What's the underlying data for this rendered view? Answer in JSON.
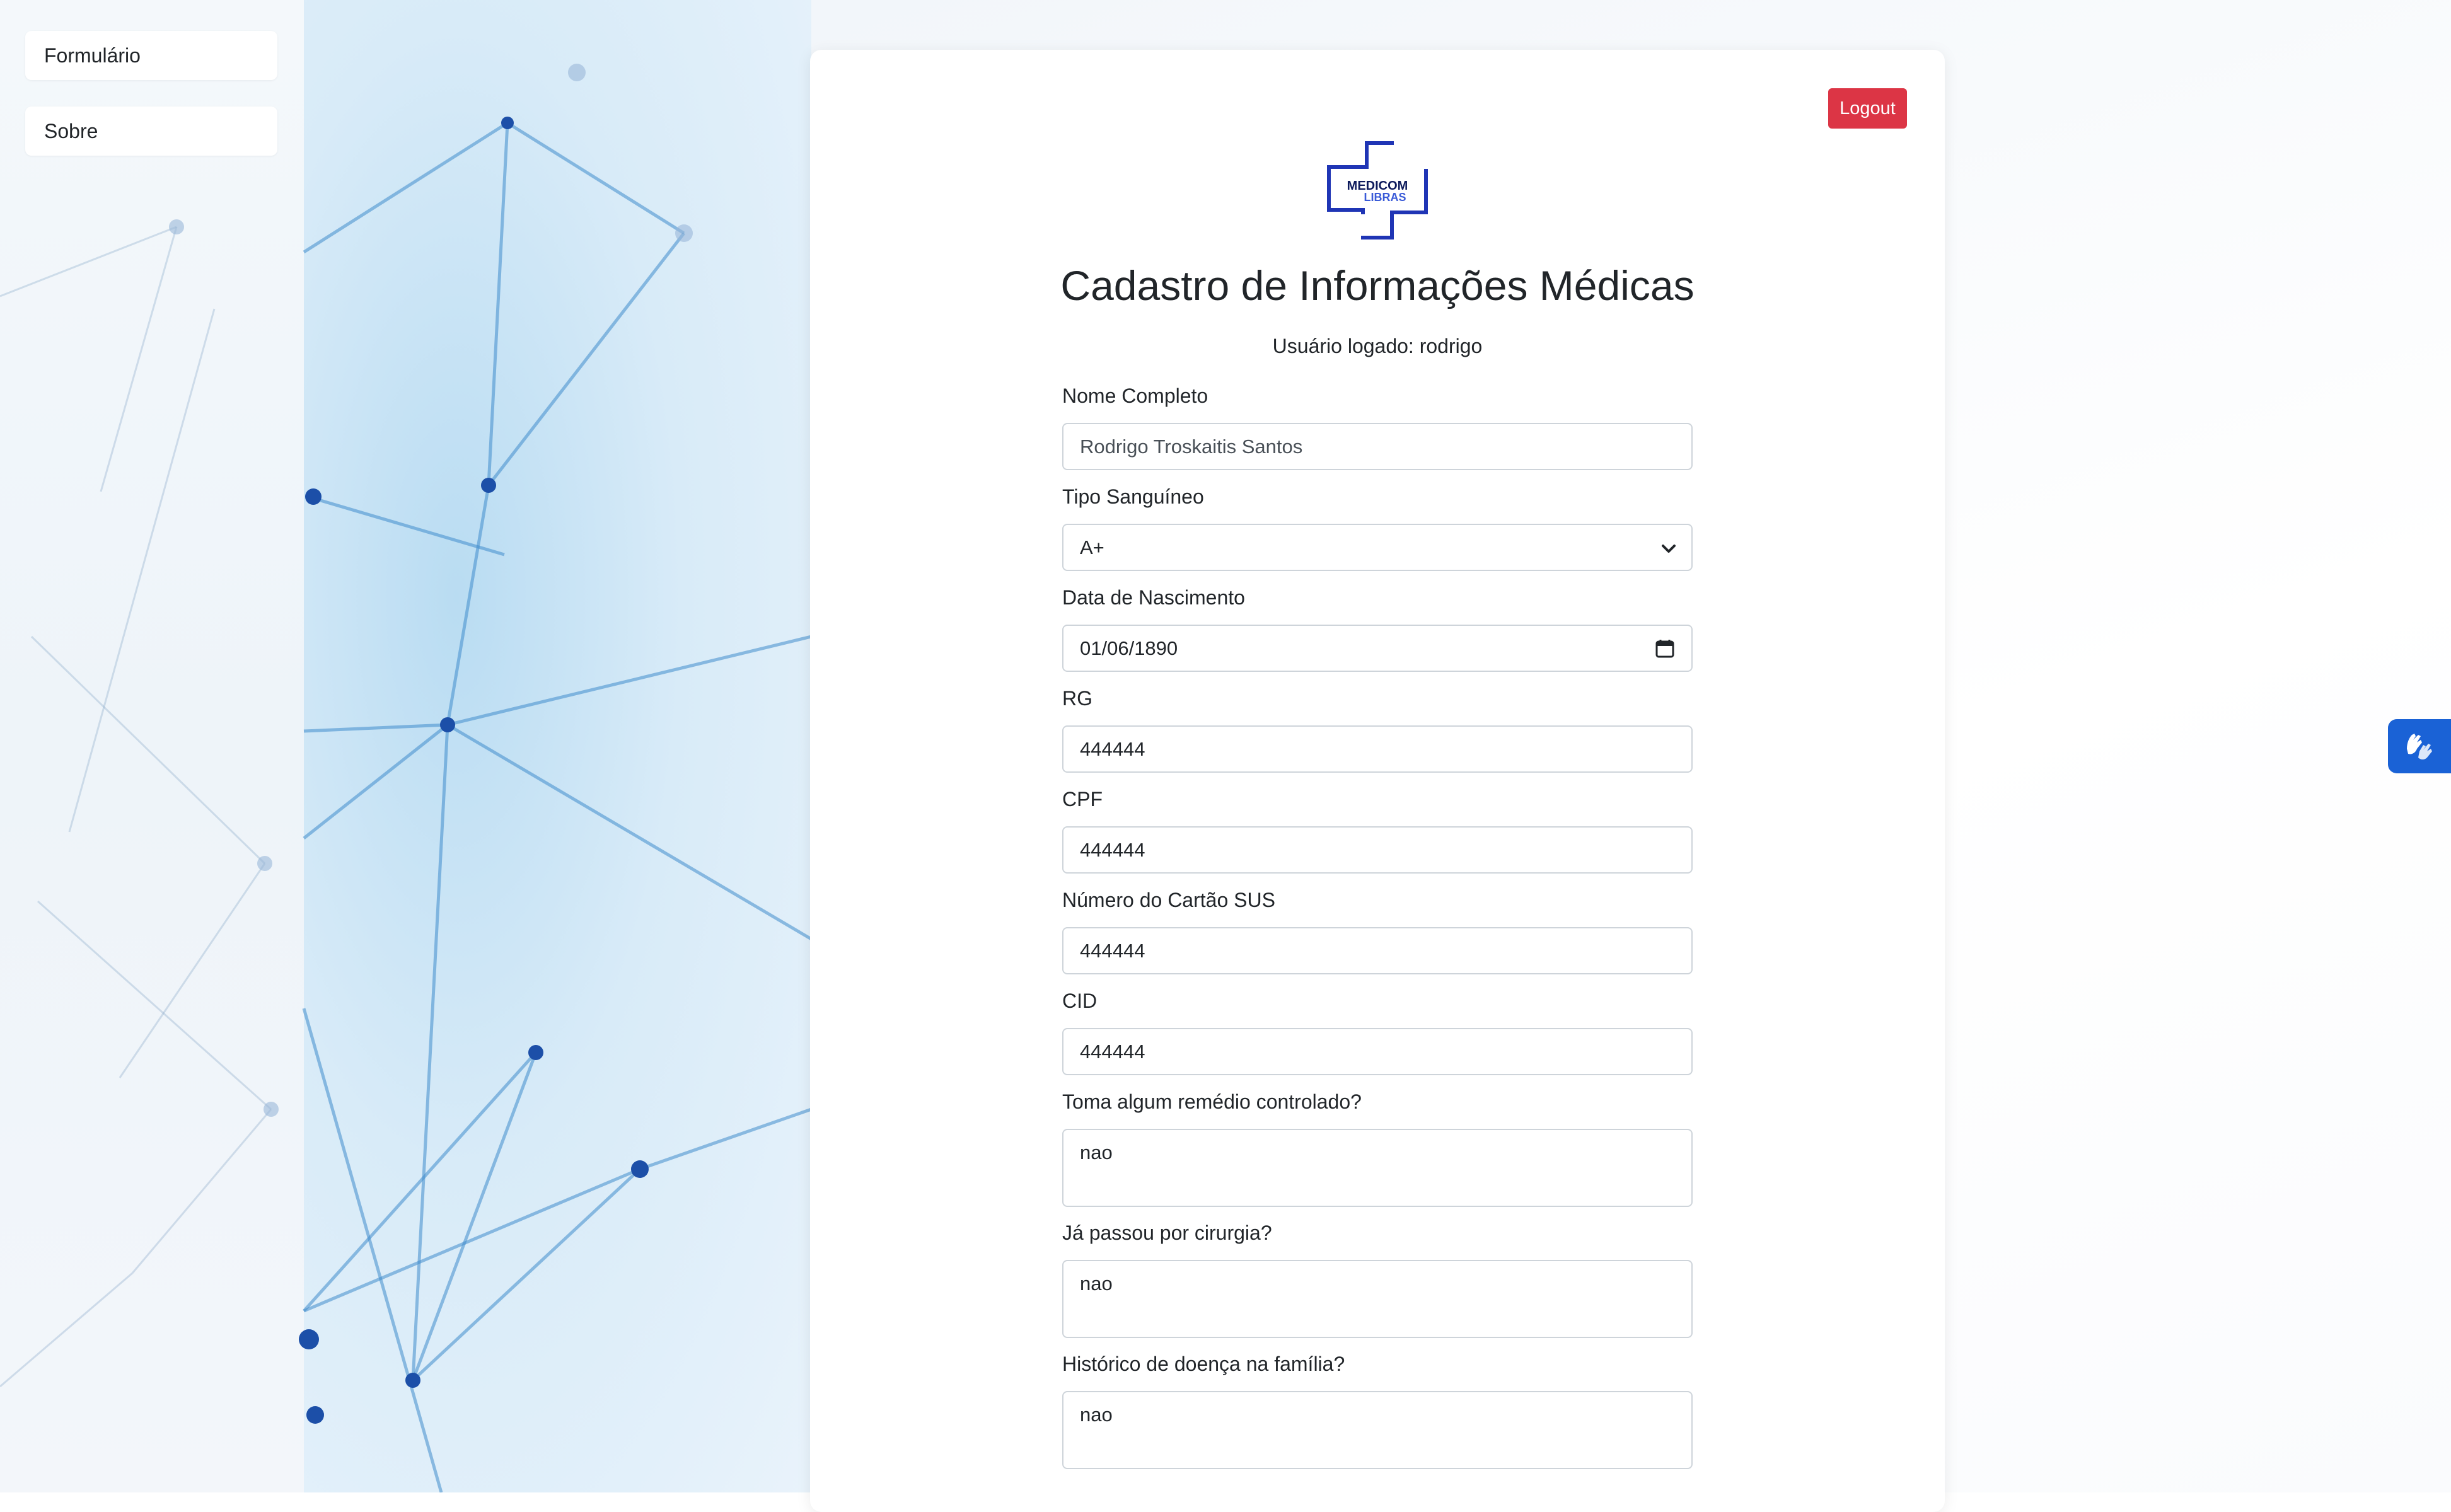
{
  "sidebar": {
    "items": [
      {
        "label": "Formulário"
      },
      {
        "label": "Sobre"
      }
    ]
  },
  "header": {
    "logout_label": "Logout",
    "logo_text_top": "MEDICOM",
    "logo_text_bottom": "LIBRAS",
    "title": "Cadastro de Informações Médicas",
    "logged_user": "Usuário logado: rodrigo"
  },
  "form": {
    "nome": {
      "label": "Nome Completo",
      "value": "Rodrigo Troskaitis Santos"
    },
    "tipo_sanguineo": {
      "label": "Tipo Sanguíneo",
      "value": "A+"
    },
    "nascimento": {
      "label": "Data de Nascimento",
      "value": "01/06/1890"
    },
    "rg": {
      "label": "RG",
      "value": "444444"
    },
    "cpf": {
      "label": "CPF",
      "value": "444444"
    },
    "sus": {
      "label": "Número do Cartão SUS",
      "value": "444444"
    },
    "cid": {
      "label": "CID",
      "value": "444444"
    },
    "remedio": {
      "label": "Toma algum remédio controlado?",
      "value": "nao"
    },
    "cirurgia": {
      "label": "Já passou por cirurgia?",
      "value": "nao"
    },
    "historico": {
      "label": "Histórico de doença na família?",
      "value": "nao"
    }
  },
  "colors": {
    "logout": "#dc3545",
    "logo_blue": "#1f35b5",
    "a11y_button": "#1a62d6"
  },
  "icons": {
    "select_arrow": "chevron-down-icon",
    "date_picker": "calendar-icon",
    "accessibility": "sign-language-hands-icon"
  }
}
